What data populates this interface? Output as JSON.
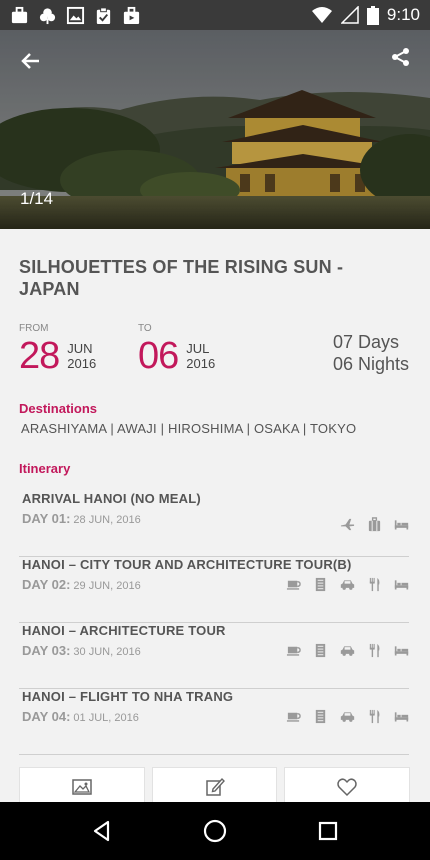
{
  "status_bar": {
    "time": "9:10",
    "icons": [
      "briefcase-icon",
      "leaf-icon",
      "image-icon",
      "clipboard-icon",
      "bag-icon",
      "wifi-icon",
      "signal-icon",
      "battery-icon"
    ]
  },
  "hero": {
    "counter": "1/14",
    "back_icon": "arrow-left-icon",
    "share_icon": "share-icon"
  },
  "tour": {
    "title": "SILHOUETTES OF THE RISING SUN - JAPAN",
    "from": {
      "label": "FROM",
      "day": "28",
      "month": "JUN",
      "year": "2016"
    },
    "to": {
      "label": "TO",
      "day": "06",
      "month": "JUL",
      "year": "2016"
    },
    "days": "07 Days",
    "nights": "06 Nights"
  },
  "destinations": {
    "heading": "Destinations",
    "list": "ARASHIYAMA | AWAJI | HIROSHIMA | OSAKA | TOKYO"
  },
  "itinerary": {
    "heading": "Itinerary",
    "items": [
      {
        "title": "ARRIVAL HANOI (NO MEAL)",
        "day": "DAY 01:",
        "date": "28 JUN, 2016",
        "icons": [
          "plane-icon",
          "luggage-icon",
          "bed-icon"
        ]
      },
      {
        "title": "HANOI – CITY TOUR AND ARCHITECTURE  TOUR(B)",
        "day": "DAY 02:",
        "date": "29 JUN, 2016",
        "icons": [
          "coffee-icon",
          "building-icon",
          "car-icon",
          "restaurant-icon",
          "bed-icon"
        ]
      },
      {
        "title": "HANOI – ARCHITECTURE TOUR",
        "day": "DAY 03:",
        "date": "30 JUN, 2016",
        "icons": [
          "coffee-icon",
          "building-icon",
          "car-icon",
          "restaurant-icon",
          "bed-icon"
        ]
      },
      {
        "title": "HANOI – FLIGHT TO NHA TRANG",
        "day": "DAY 04:",
        "date": "01 JUL, 2016",
        "icons": [
          "coffee-icon",
          "building-icon",
          "car-icon",
          "restaurant-icon",
          "bed-icon"
        ]
      }
    ]
  },
  "actions": [
    "gallery-icon",
    "edit-icon",
    "heart-icon"
  ],
  "nav": [
    "back-triangle-icon",
    "home-circle-icon",
    "recents-square-icon"
  ],
  "colors": {
    "accent": "#c2185b",
    "status_bar": "#3a3a3a",
    "nav_bar": "#000000"
  }
}
